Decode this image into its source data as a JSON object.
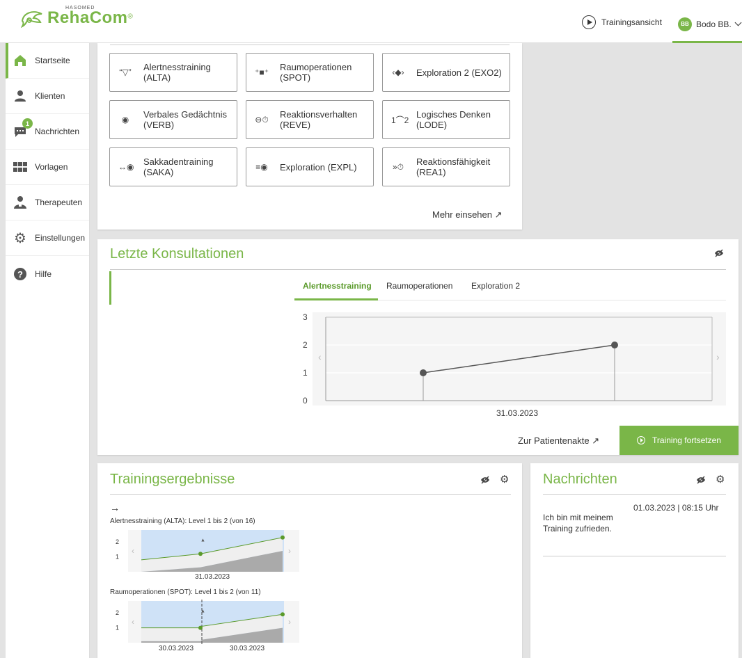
{
  "header": {
    "logo_small": "HASOMED",
    "logo_main": "RehaCom",
    "logo_reg": "®",
    "training_view": "Trainingsansicht",
    "user_initials": "BB",
    "user_name": "Bodo BB."
  },
  "sidebar": {
    "items": [
      {
        "label": "Startseite",
        "icon": "home-icon"
      },
      {
        "label": "Klienten",
        "icon": "person-icon"
      },
      {
        "label": "Nachrichten",
        "icon": "chat-icon",
        "badge": "1"
      },
      {
        "label": "Vorlagen",
        "icon": "grid-icon"
      },
      {
        "label": "Therapeuten",
        "icon": "therapist-icon"
      },
      {
        "label": "Einstellungen",
        "icon": "gear-icon"
      },
      {
        "label": "Hilfe",
        "icon": "help-icon"
      }
    ]
  },
  "trainings": {
    "tiles": [
      {
        "label1": "Alertnesstraining",
        "label2": "(ALTA)",
        "icon": "bell-icon",
        "glyph": "“▽”"
      },
      {
        "label1": "Raumoperationen",
        "label2": "(SPOT)",
        "icon": "spot-icon",
        "glyph": "⁺■⁺"
      },
      {
        "label1": "Exploration 2 (EXO2)",
        "label2": "",
        "icon": "explore-eye-icon",
        "glyph": "‹◆›"
      },
      {
        "label1": "Verbales Gedächtnis",
        "label2": "(VERB)",
        "icon": "head-icon",
        "glyph": "◉"
      },
      {
        "label1": "Reaktionsverhalten",
        "label2": "(REVE)",
        "icon": "timer-icon",
        "glyph": "⊖⏱"
      },
      {
        "label1": "Logisches Denken",
        "label2": "(LODE)",
        "icon": "sequence-icon",
        "glyph": "1⌒2"
      },
      {
        "label1": "Sakkadentraining",
        "label2": "(SAKA)",
        "icon": "saccade-eye-icon",
        "glyph": "↔◉"
      },
      {
        "label1": "Exploration (EXPL)",
        "label2": "",
        "icon": "scan-eye-icon",
        "glyph": "≡◉"
      },
      {
        "label1": "Reaktionsfähigkeit",
        "label2": "(REA1)",
        "icon": "stopwatch-icon",
        "glyph": "»⏱"
      }
    ],
    "more": "Mehr einsehen ↗"
  },
  "consultations": {
    "title": "Letzte Konsultationen",
    "tabs": [
      "Alertnesstraining",
      "Raumoperationen",
      "Exploration 2"
    ],
    "active_tab": 0,
    "patient_link": "Zur Patientenakte ↗",
    "continue_button": "Training fortsetzen"
  },
  "results": {
    "title": "Trainingsergebnisse",
    "arrow": "→",
    "item1": "Alertnesstraining (ALTA): Level 1 bis 2 (von 16)",
    "item1_date": "31.03.2023",
    "item2": "Raumoperationen (SPOT): Level 1 bis 2 (von 11)",
    "item2_dates": [
      "30.03.2023",
      "30.03.2023"
    ]
  },
  "messages": {
    "title": "Nachrichten",
    "timestamp": "01.03.2023 | 08:15 Uhr",
    "text_line1": "Ich bin mit meinem",
    "text_line2": "Training zufrieden."
  },
  "chart_data": [
    {
      "type": "line",
      "x": [
        "31.03.2023 a",
        "31.03.2023 b"
      ],
      "xlabel_shown": "31.03.2023",
      "values": [
        1,
        2
      ],
      "ylim": [
        0,
        3
      ],
      "yticks": [
        0,
        1,
        2,
        3
      ],
      "grid": true,
      "line_color": "#555555"
    },
    {
      "type": "line",
      "x": [
        "31.03.2023",
        "",
        ""
      ],
      "values": [
        0.8,
        1.2,
        2.3
      ],
      "ylim": [
        0,
        2.8
      ],
      "yticks": [
        1,
        2
      ],
      "line_color": "#5a9a2a"
    },
    {
      "type": "line",
      "x": [
        "30.03.2023",
        "",
        "30.03.2023",
        ""
      ],
      "values": [
        1,
        1,
        1.1,
        1.9
      ],
      "ylim": [
        0,
        2.8
      ],
      "yticks": [
        1,
        2
      ],
      "line_color": "#5a9a2a"
    }
  ],
  "colors": {
    "accent": "#7ab648",
    "accent_dark": "#5a9a2a",
    "chart_band": "#cfe2f7"
  }
}
